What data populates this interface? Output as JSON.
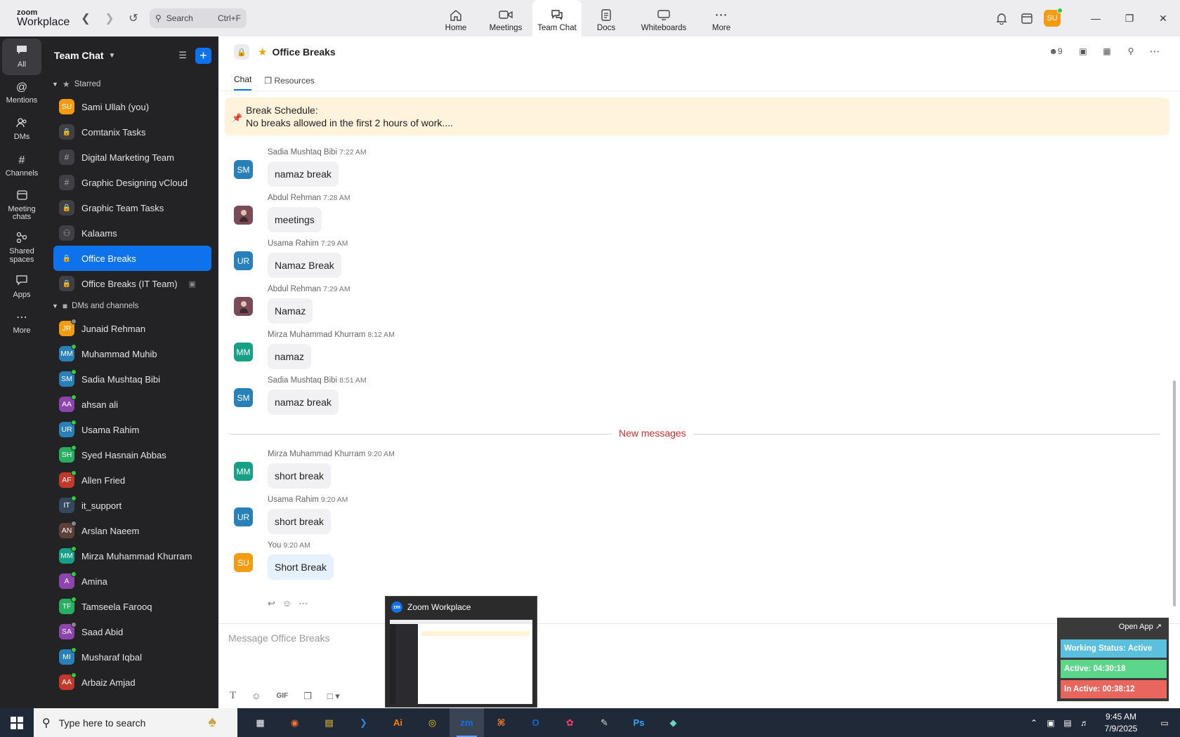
{
  "app": {
    "logo_top": "zoom",
    "logo_bottom": "Workplace"
  },
  "search": {
    "label": "Search",
    "shortcut": "Ctrl+F"
  },
  "main_nav": [
    {
      "label": "Home",
      "icon": "home-icon",
      "active": false
    },
    {
      "label": "Meetings",
      "icon": "video-icon",
      "active": false
    },
    {
      "label": "Team Chat",
      "icon": "chat-icon",
      "active": true
    },
    {
      "label": "Docs",
      "icon": "doc-icon",
      "active": false
    },
    {
      "label": "Whiteboards",
      "icon": "whiteboard-icon",
      "active": false
    },
    {
      "label": "More",
      "icon": "more-icon",
      "active": false
    }
  ],
  "user": {
    "initials": "SU",
    "status": "available"
  },
  "rail": [
    {
      "label": "All",
      "active": true
    },
    {
      "label": "Mentions"
    },
    {
      "label": "DMs"
    },
    {
      "label": "Channels"
    },
    {
      "label": "Meeting chats"
    },
    {
      "label": "Shared spaces"
    },
    {
      "label": "Apps"
    },
    {
      "label": "More"
    }
  ],
  "sidebar": {
    "title": "Team Chat",
    "section_starred": "Starred",
    "starred": [
      {
        "name": "Sami Ullah (you)",
        "initials": "SU",
        "color": "#f39c12",
        "kind": "person"
      },
      {
        "name": "Comtanix Tasks",
        "kind": "lock"
      },
      {
        "name": "Digital Marketing Team",
        "kind": "hash"
      },
      {
        "name": "Graphic Designing vCloud",
        "kind": "hash"
      },
      {
        "name": "Graphic Team Tasks",
        "kind": "lock"
      },
      {
        "name": "Kalaams",
        "kind": "group"
      },
      {
        "name": "Office Breaks",
        "kind": "lock",
        "selected": true
      },
      {
        "name": "Office Breaks (IT Team)",
        "kind": "lock",
        "archived": true
      }
    ],
    "section_dms": "DMs and channels",
    "dms": [
      {
        "name": "Junaid Rehman",
        "initials": "JR",
        "color": "#f39c12",
        "status": "off"
      },
      {
        "name": "Muhammad Muhib",
        "initials": "MM",
        "color": "#2980b9",
        "status": "on"
      },
      {
        "name": "Sadia Mushtaq Bibi",
        "initials": "SM",
        "color": "#2980b9",
        "status": "on"
      },
      {
        "name": "ahsan ali",
        "initials": "AA",
        "color": "#8e44ad",
        "status": "on"
      },
      {
        "name": "Usama Rahim",
        "initials": "UR",
        "color": "#2980b9",
        "status": "on"
      },
      {
        "name": "Syed Hasnain Abbas",
        "initials": "SH",
        "color": "#27ae60",
        "status": "on"
      },
      {
        "name": "Allen Fried",
        "initials": "AF",
        "color": "#c0392b",
        "status": "on"
      },
      {
        "name": "it_support",
        "initials": "IT",
        "color": "#34495e",
        "status": "on"
      },
      {
        "name": "Arslan Naeem",
        "initials": "AN",
        "color": "#5d4037",
        "status": "off"
      },
      {
        "name": "Mirza Muhammad Khurram",
        "initials": "MM",
        "color": "#16a085",
        "status": "on"
      },
      {
        "name": "Amina",
        "initials": "A",
        "color": "#8e44ad",
        "status": "on"
      },
      {
        "name": "Tamseela Farooq",
        "initials": "TF",
        "color": "#27ae60",
        "status": "on"
      },
      {
        "name": "Saad Abid",
        "initials": "SA",
        "color": "#8e44ad",
        "status": "off"
      },
      {
        "name": "Musharaf Iqbal",
        "initials": "MI",
        "color": "#2980b9",
        "status": "on"
      },
      {
        "name": "Arbaiz Amjad",
        "initials": "AA",
        "color": "#c0392b",
        "status": "on"
      }
    ]
  },
  "channel": {
    "title": "Office Breaks",
    "members": "9",
    "tabs": [
      "Chat",
      "Resources"
    ],
    "pinned_title": "Break Schedule:",
    "pinned_text": "No breaks allowed in the first 2 hours of work....",
    "new_messages": "New messages",
    "messages_before": [
      {
        "sender": "Sadia Mushtaq Bibi",
        "time": "7:22 AM",
        "text": "namaz break",
        "initials": "SM",
        "color": "#2980b9"
      },
      {
        "sender": "Abdul Rehman",
        "time": "7:28 AM",
        "text": "meetings",
        "initials": "",
        "color": "#7b4a57"
      },
      {
        "sender": "Usama Rahim",
        "time": "7:29 AM",
        "text": "Namaz Break",
        "initials": "UR",
        "color": "#2980b9"
      },
      {
        "sender": "Abdul Rehman",
        "time": "7:29 AM",
        "text": "Namaz",
        "initials": "",
        "color": "#7b4a57"
      },
      {
        "sender": "Mirza Muhammad Khurram",
        "time": "8:12 AM",
        "text": "namaz",
        "initials": "MM",
        "color": "#16a085"
      },
      {
        "sender": "Sadia Mushtaq Bibi",
        "time": "8:51 AM",
        "text": "namaz break",
        "initials": "SM",
        "color": "#2980b9"
      }
    ],
    "messages_after": [
      {
        "sender": "Mirza Muhammad Khurram",
        "time": "9:20 AM",
        "text": "short break",
        "initials": "MM",
        "color": "#16a085"
      },
      {
        "sender": "Usama Rahim",
        "time": "9:20 AM",
        "text": "short break",
        "initials": "UR",
        "color": "#2980b9"
      },
      {
        "sender": "You",
        "time": "9:20 AM",
        "text": "Short Break",
        "initials": "SU",
        "color": "#f39c12",
        "mine": true
      }
    ],
    "composer_placeholder": "Message Office Breaks"
  },
  "thumbnail": {
    "title": "Zoom Workplace",
    "badge": "zm"
  },
  "widget": {
    "open_app": "Open App ↗",
    "working_status": "Working Status: Active",
    "active": "Active: 04:30:18",
    "inactive": "In Active: 00:38:12",
    "colors": {
      "status": "#5bc0de",
      "active": "#5cd68a",
      "inactive": "#e8665e"
    }
  },
  "taskbar": {
    "search_placeholder": "Type here to search",
    "apps": [
      {
        "label": "▦",
        "name": "taskview"
      },
      {
        "label": "◉",
        "name": "firefox"
      },
      {
        "label": "▤",
        "name": "explorer"
      },
      {
        "label": "❯",
        "name": "vscode"
      },
      {
        "label": "Ai",
        "name": "illustrator"
      },
      {
        "label": "◎",
        "name": "chrome"
      },
      {
        "label": "zm",
        "name": "zoom",
        "active": true
      },
      {
        "label": "⌘",
        "name": "xampp"
      },
      {
        "label": "O",
        "name": "outlook"
      },
      {
        "label": "✿",
        "name": "creative-cloud"
      },
      {
        "label": "✎",
        "name": "inkscape"
      },
      {
        "label": "Ps",
        "name": "photoshop"
      },
      {
        "label": "◆",
        "name": "app"
      }
    ],
    "time": "9:45 AM",
    "date": "7/9/2025"
  }
}
